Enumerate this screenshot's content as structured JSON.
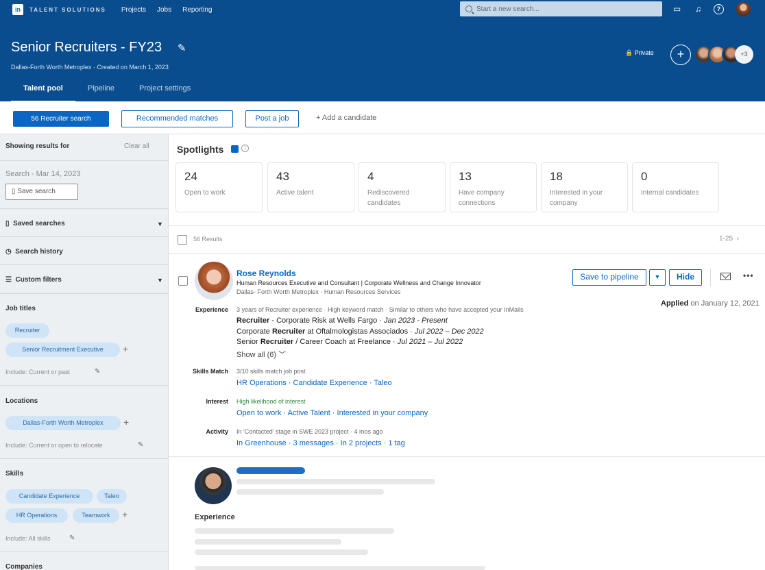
{
  "topnav": {
    "logo": "in",
    "brand": "TALENT SOLUTIONS",
    "links": [
      "Projects",
      "Jobs",
      "Reporting"
    ],
    "search_placeholder": "Start a new search...",
    "icons": [
      "messages-icon",
      "bell-icon",
      "help-icon",
      "avatar"
    ]
  },
  "project": {
    "title": "Senior Recruiters - FY23",
    "subtitle": "Dallas-Forth Worth Metroplex · Created on March 1, 2023",
    "privacy": "Private",
    "add_symbol": "+",
    "team_more": "+3",
    "tabs": [
      "Talent pool",
      "Pipeline",
      "Project settings"
    ],
    "active_tab": "Talent pool"
  },
  "actions": {
    "recruiter_search": "56 Recruiter search",
    "recommended": "Recommended matches",
    "post_job": "Post a job",
    "add_candidate": "+ Add a candidate"
  },
  "filters": {
    "showing": "Showing results for",
    "clear_all": "Clear all",
    "search_date": "Search - Mar 14, 2023",
    "save_search": "Save search",
    "saved_searches": "Saved searches",
    "search_history": "Search history",
    "custom_filters": "Custom filters",
    "job_titles": {
      "heading": "Job titles",
      "pills": [
        "Recruiter",
        "Senior Recruitment Executive"
      ],
      "include": "Include: Current or past"
    },
    "locations": {
      "heading": "Locations",
      "pills": [
        "Dallas-Forth Worth Metroplex"
      ],
      "include": "Include: Current or open to relocate"
    },
    "skills": {
      "heading": "Skills",
      "pills": [
        "Candidate Experience",
        "Taleo",
        "HR Operations",
        "Teamwork"
      ],
      "include": "Include: All skills"
    },
    "companies": {
      "heading": "Companies"
    }
  },
  "spotlights": {
    "title": "Spotlights",
    "info_symbol": "i",
    "cards": [
      {
        "count": "24",
        "label": "Open to work"
      },
      {
        "count": "43",
        "label": "Active talent"
      },
      {
        "count": "4",
        "label": "Rediscovered candidates"
      },
      {
        "count": "13",
        "label": "Have company connections"
      },
      {
        "count": "18",
        "label": "Interested in your company"
      },
      {
        "count": "0",
        "label": "Internal candidates"
      }
    ]
  },
  "results": {
    "count_label": "56 Results",
    "pager": "1-25",
    "pager_next": "›"
  },
  "candidate": {
    "name": "Rose Reynolds",
    "headline": "Human Resources Executive and Consultant | Corporate Wellness and Change Innovator",
    "location": "Dallas- Forth Worth Metroplex · Human Resources Services",
    "save_pipeline": "Save to pipeline",
    "dropdown_symbol": "▼",
    "hide": "Hide",
    "more_symbol": "•••",
    "applied_bold": "Applied",
    "applied_rest": " on January 12, 2021",
    "experience_label": "Experience",
    "experience_meta": "3 years of Recruiter experience · High keyword match · Similar to others who have accepted your InMails",
    "experience": [
      {
        "bold": "Recruiter",
        "rest": " - Corporate Risk at Wells Fargo · ",
        "dates": "Jan 2023 - Present"
      },
      {
        "pre": "Corporate ",
        "bold": "Recruiter",
        "rest": " at Oftalmologistas Associados · ",
        "dates": "Jul 2022 – Dec 2022"
      },
      {
        "pre": "Senior ",
        "bold": "Recruiter",
        "rest": " / Career Coach at Freelance · ",
        "dates": "Jul 2021 – Jul 2022"
      }
    ],
    "show_all": "Show all (6) ﹀",
    "skills_label": "Skills Match",
    "skills_meta": "3/10 skills match job post",
    "skills_links": "HR Operations  ·  Candidate Experience  ·  Taleo",
    "interest_label": "Interest",
    "interest_meta": "High likelihood of interest",
    "interest_links": "Open to work  ·  Active Talent  ·  Interested in your company",
    "activity_label": "Activity",
    "activity_meta": "In 'Contacted' stage in SWE 2023 project  ·  4 mos ago",
    "activity_links": "In Greenhouse  ·  3 messages  ·  In 2 projects  ·  1 tag"
  },
  "candidate2": {
    "experience_label": "Experience"
  },
  "colors": {
    "brand_blue": "#0a4d8f",
    "link_blue": "#0a66c2",
    "pill_bg": "#cfe4f7",
    "interest_green": "#2a8a3e"
  }
}
